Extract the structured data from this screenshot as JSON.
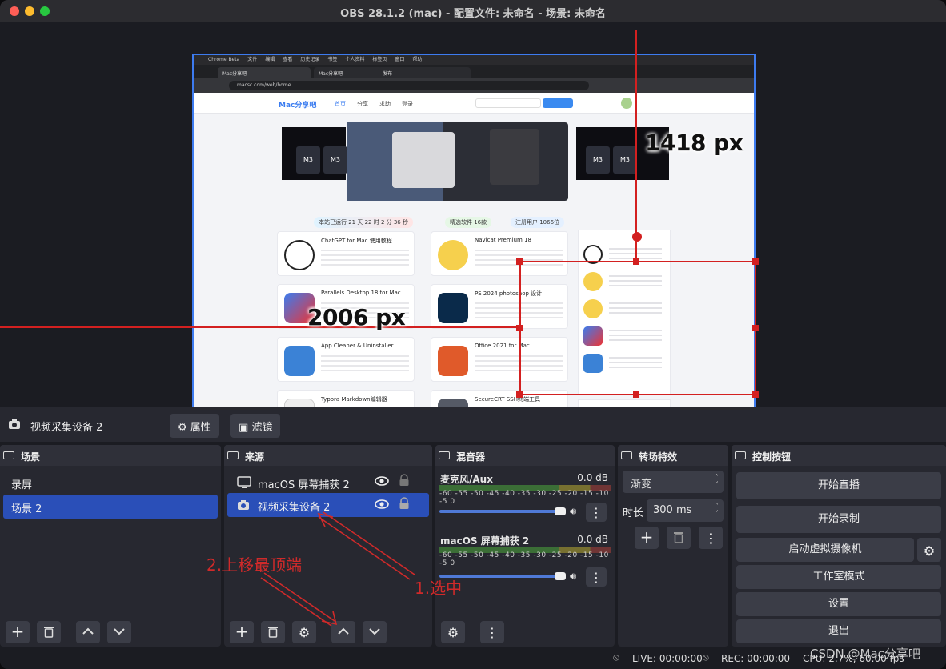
{
  "window": {
    "title": "OBS 28.1.2 (mac) - 配置文件: 未命名 - 场景: 未命名"
  },
  "preview": {
    "browser_menu": [
      "Chrome Beta",
      "文件",
      "编辑",
      "查看",
      "历史记录",
      "书签",
      "个人资料",
      "标签页",
      "窗口",
      "帮助"
    ],
    "tabs": [
      "Mac分享吧",
      "Mac分享吧",
      "发布"
    ],
    "address": "macsc.com/web/home",
    "site_nav": [
      "首页",
      "分享",
      "求助",
      "登录"
    ],
    "stats": [
      "本站已运行 21 天 22 时 2 分 36 秒",
      "精选软件 16款",
      "注册用户 1066位"
    ],
    "cards": [
      {
        "title": "ChatGPT for Mac 使用教程"
      },
      {
        "title": "Navicat Premium 18"
      },
      {
        "title": "Parallels Desktop 18 for Mac"
      },
      {
        "title": "PS 2024 photoshop 设计"
      },
      {
        "title": "App Cleaner & Uninstaller"
      },
      {
        "title": "Office 2021 for Mac"
      },
      {
        "title": "Typora Markdown编辑器"
      },
      {
        "title": "SecureCRT SSH终端工具"
      }
    ],
    "banner_chips": [
      "M3",
      "M3"
    ],
    "dim_width": "2006 px",
    "dim_height": "1418 px"
  },
  "source_toolbar": {
    "name": "视频采集设备 2",
    "properties": "属性",
    "filters": "滤镜"
  },
  "scenes": {
    "title": "场景",
    "items": [
      "录屏",
      "场景 2"
    ]
  },
  "sources": {
    "title": "来源",
    "items": [
      "macOS 屏幕捕获 2",
      "视频采集设备 2"
    ]
  },
  "mixer": {
    "title": "混音器",
    "channels": [
      {
        "name": "麦克风/Aux",
        "db": "0.0 dB"
      },
      {
        "name": "macOS 屏幕捕获 2",
        "db": "0.0 dB"
      }
    ],
    "scale": "-60 -55 -50 -45 -40 -35 -30 -25 -20 -15 -10 -5  0"
  },
  "transitions": {
    "title": "转场特效",
    "type": "渐变",
    "duration_label": "时长",
    "duration": "300 ms"
  },
  "controls": {
    "title": "控制按钮",
    "start_stream": "开始直播",
    "start_record": "开始录制",
    "virtual_cam": "启动虚拟摄像机",
    "studio_mode": "工作室模式",
    "settings": "设置",
    "exit": "退出"
  },
  "status": {
    "live": "LIVE: 00:00:00",
    "rec": "REC: 00:00:00",
    "cpu": "CPU: 2.7%, 60.00 fps"
  },
  "annotations": {
    "select": "1.选中",
    "move_top": "2.上移最顶端"
  },
  "watermark": "CSDN @Mac分享吧",
  "colors": {
    "accent": "#2a4fb8",
    "annotation": "#d02a2a",
    "selection_border": "#3d7bf0"
  }
}
